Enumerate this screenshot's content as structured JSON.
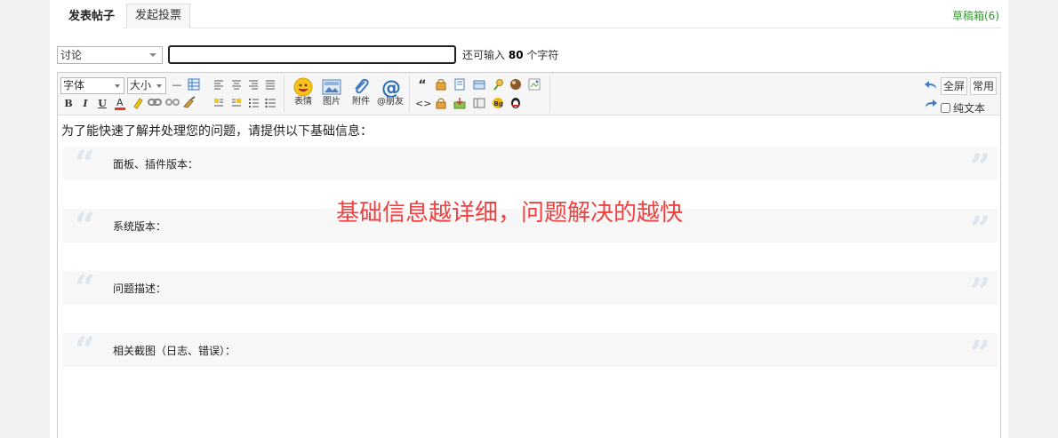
{
  "tabs": [
    {
      "label": "发表帖子",
      "active": true
    },
    {
      "label": "发起投票",
      "active": false
    }
  ],
  "drafts_label": "草稿箱(6)",
  "type_select": {
    "value": "讨论"
  },
  "subject": {
    "value": ""
  },
  "remaining": {
    "prefix": "还可输入",
    "count": "80",
    "suffix": "个字符"
  },
  "toolbar": {
    "font_label": "字体",
    "size_label": "大小",
    "hr_glyph": "—",
    "emotion_label": "表情",
    "image_label": "图片",
    "attach_label": "附件",
    "at_label": "@朋友",
    "fullscreen_label": "全屏",
    "common_label": "常用",
    "plaintext_label": "纯文本",
    "bold": "B",
    "italic": "I",
    "underline": "U",
    "quote_glyph": "“",
    "code_glyph": "<>"
  },
  "content": {
    "intro": "为了能快速了解并处理您的问题，请提供以下基础信息：",
    "quotes": [
      "面板、插件版本：",
      "系统版本：",
      "问题描述：",
      "相关截图（日志、错误）："
    ],
    "hint": "基础信息越详细，问题解决的越快"
  },
  "colors": {
    "drafts": "#2e9c2e",
    "hint": "#f04040",
    "quote_mark": "#dde6ee"
  }
}
